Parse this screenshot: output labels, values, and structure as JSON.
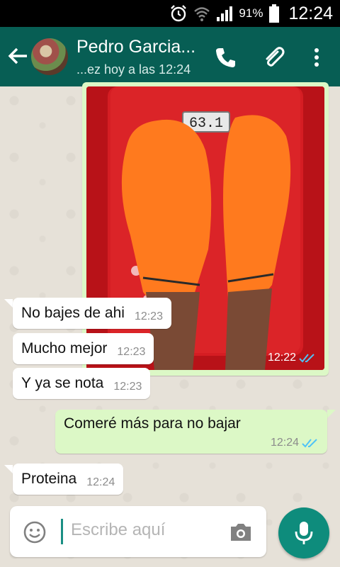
{
  "status_bar": {
    "battery_percent": "91%",
    "time": "12:24"
  },
  "header": {
    "contact_name": "Pedro Garcia...",
    "last_seen": "...ez hoy a las 12:24"
  },
  "image_message": {
    "time": "12:22",
    "scale_reading": "63.1"
  },
  "messages": [
    {
      "text": "No bajes de ahi",
      "time": "12:23",
      "direction": "in"
    },
    {
      "text": "Mucho mejor",
      "time": "12:23",
      "direction": "in"
    },
    {
      "text": "Y ya se nota",
      "time": "12:23",
      "direction": "in"
    },
    {
      "text": "Comeré más para no bajar",
      "time": "12:24",
      "direction": "out"
    },
    {
      "text": "Proteina",
      "time": "12:24",
      "direction": "in"
    }
  ],
  "composer": {
    "placeholder": "Escribe aquí"
  },
  "colors": {
    "app_bar": "#075e54",
    "outgoing": "#dcf8c6",
    "fab": "#0e8c7c",
    "read_ticks": "#4fc3f7"
  },
  "icons": [
    "alarm-icon",
    "wifi-icon",
    "signal-icon",
    "battery-icon",
    "back-arrow-icon",
    "phone-icon",
    "attach-icon",
    "more-icon",
    "double-check-icon",
    "emoji-icon",
    "camera-icon",
    "mic-icon"
  ]
}
